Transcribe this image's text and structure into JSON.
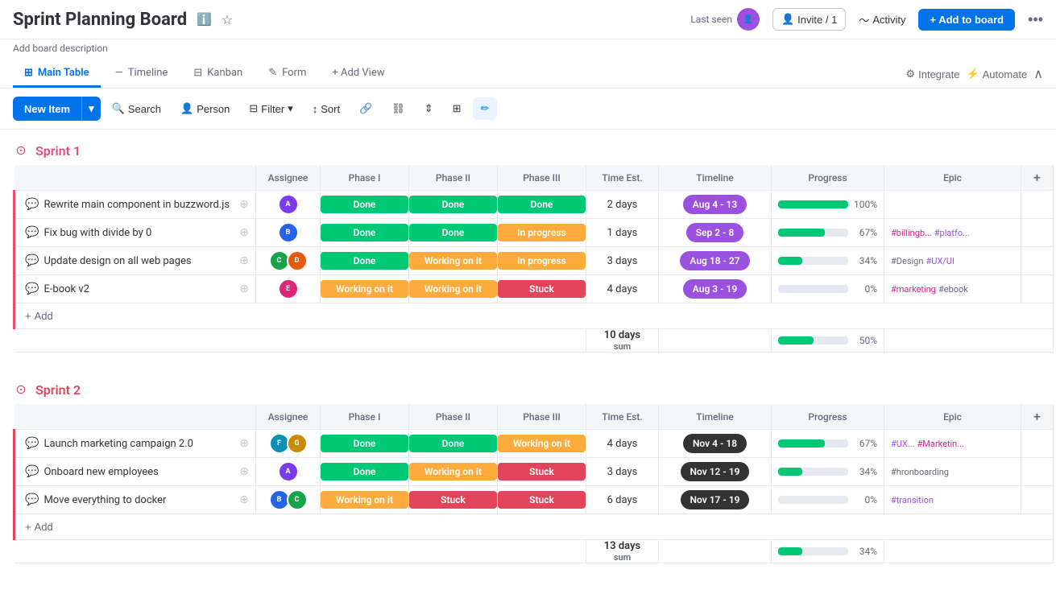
{
  "header": {
    "title": "Sprint Planning Board",
    "info_icon": "ℹ",
    "star_icon": "☆",
    "last_seen_label": "Last seen",
    "invite_label": "Invite / 1",
    "activity_label": "Activity",
    "add_to_board_label": "+ Add to board",
    "more_icon": "•••",
    "board_desc": "Add board description"
  },
  "tabs": [
    {
      "id": "main-table",
      "label": "Main Table",
      "active": true,
      "icon": "⊞"
    },
    {
      "id": "timeline",
      "label": "Timeline",
      "active": false,
      "icon": "—"
    },
    {
      "id": "kanban",
      "label": "Kanban",
      "active": false,
      "icon": "⊟"
    },
    {
      "id": "form",
      "label": "Form",
      "active": false,
      "icon": "✎"
    },
    {
      "id": "add-view",
      "label": "+ Add View",
      "active": false,
      "icon": ""
    }
  ],
  "tab_right": {
    "integrate": "Integrate",
    "automate": "Automate"
  },
  "toolbar": {
    "new_item": "New Item",
    "search": "Search",
    "person": "Person",
    "filter": "Filter",
    "sort": "Sort"
  },
  "columns": [
    "Assignee",
    "Phase I",
    "Phase II",
    "Phase III",
    "Time Est.",
    "Timeline",
    "Progress",
    "Epic"
  ],
  "sprint1": {
    "name": "Sprint 1",
    "rows": [
      {
        "task": "Rewrite main component in buzzword.js",
        "assignee": [
          "av1"
        ],
        "phase1": "Done",
        "phase1_class": "status-done",
        "phase2": "Done",
        "phase2_class": "status-done",
        "phase3": "Done",
        "phase3_class": "status-done",
        "time": "2 days",
        "timeline": "Aug 4 - 13",
        "timeline_class": "timeline-purple",
        "progress": 100,
        "progress_pct": "100%",
        "epics": []
      },
      {
        "task": "Fix bug with divide by 0",
        "assignee": [
          "av2"
        ],
        "phase1": "Done",
        "phase1_class": "status-done",
        "phase2": "Done",
        "phase2_class": "status-done",
        "phase3": "In progress",
        "phase3_class": "status-inprogress",
        "time": "1 days",
        "timeline": "Sep 2 - 8",
        "timeline_class": "timeline-purple",
        "progress": 67,
        "progress_pct": "67%",
        "epics": [
          "#billingb...",
          "#platfo..."
        ]
      },
      {
        "task": "Update design on all web pages",
        "assignee": [
          "av3",
          "av4"
        ],
        "phase1": "Done",
        "phase1_class": "status-done",
        "phase2": "Working on it",
        "phase2_class": "status-working",
        "phase3": "In progress",
        "phase3_class": "status-inprogress",
        "time": "3 days",
        "timeline": "Aug 18 - 27",
        "timeline_class": "timeline-purple",
        "progress": 34,
        "progress_pct": "34%",
        "epics": [
          "#Design",
          "#UX/UI"
        ]
      },
      {
        "task": "E-book v2",
        "assignee": [
          "av5"
        ],
        "phase1": "Working on it",
        "phase1_class": "status-working",
        "phase2": "Working on it",
        "phase2_class": "status-working",
        "phase3": "Stuck",
        "phase3_class": "status-stuck",
        "time": "4 days",
        "timeline": "Aug 3 - 19",
        "timeline_class": "timeline-purple",
        "progress": 0,
        "progress_pct": "0%",
        "epics": [
          "#marketing",
          "#ebook"
        ]
      }
    ],
    "sum_time": "10 days",
    "sum_label": "sum",
    "sum_progress": 50,
    "sum_pct": "50%"
  },
  "sprint2": {
    "name": "Sprint 2",
    "rows": [
      {
        "task": "Launch marketing campaign 2.0",
        "assignee": [
          "av6",
          "av7"
        ],
        "phase1": "Done",
        "phase1_class": "status-done",
        "phase2": "Done",
        "phase2_class": "status-done",
        "phase3": "Working on it",
        "phase3_class": "status-working",
        "time": "4 days",
        "timeline": "Nov 4 - 18",
        "timeline_class": "timeline-dark",
        "progress": 67,
        "progress_pct": "67%",
        "epics": [
          "#UX...",
          "#Marketin..."
        ]
      },
      {
        "task": "Onboard new employees",
        "assignee": [
          "av1"
        ],
        "phase1": "Done",
        "phase1_class": "status-done",
        "phase2": "Working on it",
        "phase2_class": "status-working",
        "phase3": "Stuck",
        "phase3_class": "status-stuck",
        "time": "3 days",
        "timeline": "Nov 12 - 19",
        "timeline_class": "timeline-dark",
        "progress": 34,
        "progress_pct": "34%",
        "epics": [
          "#hronboarding"
        ]
      },
      {
        "task": "Move everything to docker",
        "assignee": [
          "av2",
          "av3"
        ],
        "phase1": "Working on it",
        "phase1_class": "status-working",
        "phase2": "Stuck",
        "phase2_class": "status-stuck",
        "phase3": "Stuck",
        "phase3_class": "status-stuck",
        "time": "6 days",
        "timeline": "Nov 17 - 19",
        "timeline_class": "timeline-dark",
        "progress": 0,
        "progress_pct": "0%",
        "epics": [
          "#transition"
        ]
      }
    ],
    "sum_time": "13 days",
    "sum_label": "sum",
    "sum_progress": 34,
    "sum_pct": "34%"
  },
  "avatar_colors": {
    "av1": "#9b51e0",
    "av2": "#2563eb",
    "av3": "#16a34a",
    "av4": "#ea580c",
    "av5": "#db2777",
    "av6": "#0891b2",
    "av7": "#ca8a04"
  }
}
